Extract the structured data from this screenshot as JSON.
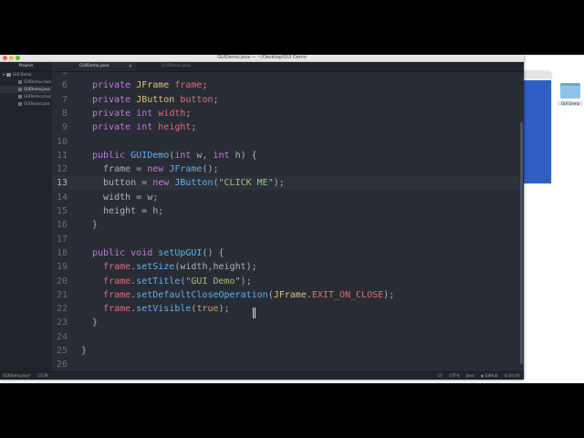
{
  "window": {
    "title": "GUIDemo.java — ~/Desktop/GUI Demo"
  },
  "sidebar": {
    "header": "Project",
    "root": "GUI Demo",
    "files": [
      "GUIDemo.class",
      "GUIDemo.java",
      "GUITester.class",
      "GUITester.java"
    ],
    "selected_index": 1
  },
  "tabs": [
    {
      "label": "GUIDemo.java",
      "close": "×"
    },
    {
      "label": "GUITester.java"
    }
  ],
  "editor": {
    "lines": [
      {
        "n": "5",
        "html": ""
      },
      {
        "n": "6",
        "html": "<span class='kw'>private</span> <span class='ty'>JFrame</span> <span class='pr'>frame</span>;"
      },
      {
        "n": "7",
        "html": "<span class='kw'>private</span> <span class='ty'>JButton</span> <span class='pr'>button</span>;"
      },
      {
        "n": "8",
        "html": "<span class='kw'>private</span> <span class='kw'>int</span> <span class='pr'>width</span>;"
      },
      {
        "n": "9",
        "html": "<span class='kw'>private</span> <span class='kw'>int</span> <span class='pr'>height</span>;"
      },
      {
        "n": "10",
        "html": ""
      },
      {
        "n": "11",
        "html": "<span class='kw'>public</span> <span class='fn'>GUIDemo</span>(<span class='kw'>int</span> w, <span class='kw'>int</span> h) {"
      },
      {
        "n": "12",
        "html": "  frame = <span class='kw'>new</span> <span class='fn'>JFrame</span>();"
      },
      {
        "n": "13",
        "html": "  button = <span class='kw'>new</span> <span class='fn'>JButton</span>(<span class='st'>\"CLICK ME\"</span>);"
      },
      {
        "n": "14",
        "html": "  width = w;"
      },
      {
        "n": "15",
        "html": "  height = h;"
      },
      {
        "n": "16",
        "html": "}"
      },
      {
        "n": "17",
        "html": ""
      },
      {
        "n": "18",
        "html": "<span class='kw'>public</span> <span class='kw'>void</span> <span class='fn'>setUpGUI</span>() {"
      },
      {
        "n": "19",
        "html": "  <span class='pr'>frame</span>.<span class='fn'>setSize</span>(width,height);"
      },
      {
        "n": "20",
        "html": "  <span class='pr'>frame</span>.<span class='fn'>setTitle</span>(<span class='st'>\"GUI Demo\"</span>);"
      },
      {
        "n": "21",
        "html": "  <span class='pr'>frame</span>.<span class='fn'>setDefaultCloseOperation</span>(<span class='ty'>JFrame</span>.<span class='pr'>EXIT_ON_CLOSE</span>);"
      },
      {
        "n": "22",
        "html": "  <span class='pr'>frame</span>.<span class='fn'>setVisible</span>(<span class='cn'>true</span>);"
      },
      {
        "n": "23",
        "html": "}"
      },
      {
        "n": "24",
        "html": ""
      },
      {
        "n": "25",
        "html": "}"
      },
      {
        "n": "26",
        "html": ""
      }
    ],
    "current_line": "13"
  },
  "statusbar": {
    "file": "GUIDemo.java*",
    "position": "13:39",
    "line_ending": "LF",
    "encoding": "UTF-8",
    "grammar": "Java",
    "github": "GitHub",
    "git": "Git (0)"
  },
  "desktop": {
    "folder_label": "GUI Demo"
  },
  "colors": {
    "editor_bg": "#282c34",
    "keyword": "#c678dd",
    "type": "#e5c07b",
    "property": "#e06c75",
    "function": "#61afef",
    "string": "#98c379"
  }
}
